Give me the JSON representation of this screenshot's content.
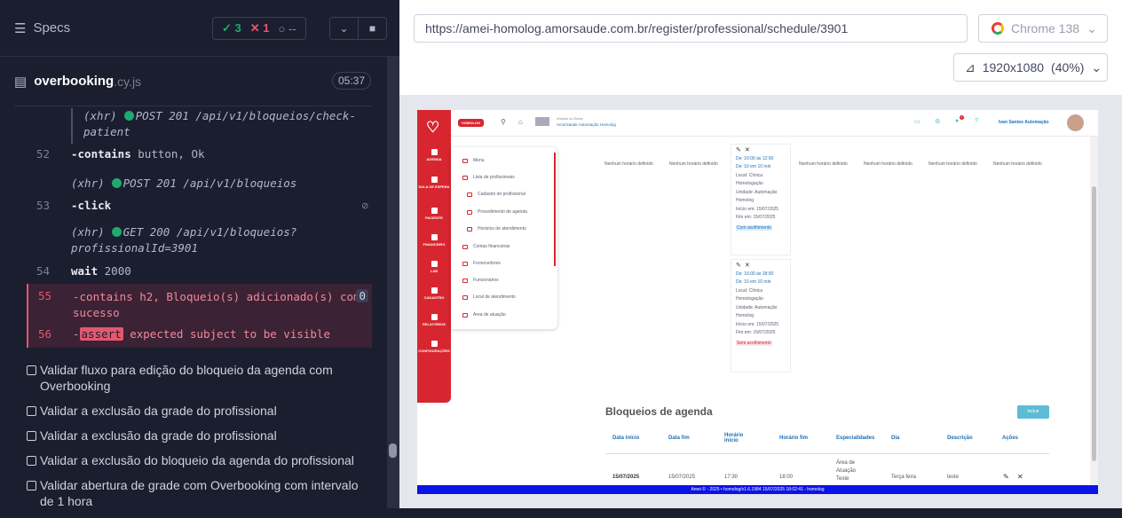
{
  "runner": {
    "specs_label": "Specs",
    "passed": "3",
    "failed": "1",
    "pending": "--",
    "file_name": "overbooking",
    "file_ext": ".cy.js",
    "timer": "05:37"
  },
  "log": [
    {
      "type": "xhr",
      "text1": "(xhr)",
      "text2": "POST 201 /api/v1/bloqueios/check-",
      "text3": "patient"
    },
    {
      "num": "52",
      "cmd": "-contains",
      "arg": "button, Ok"
    },
    {
      "type": "xhr",
      "text1": "(xhr)",
      "text2": "POST 201 /api/v1/bloqueios"
    },
    {
      "num": "53",
      "cmd": "-click"
    },
    {
      "type": "xhr",
      "text1": "(xhr)",
      "text2": "GET 200 /api/v1/bloqueios?",
      "text3": "profissionalId=3901"
    },
    {
      "num": "54",
      "cmd": "wait",
      "arg": "2000"
    },
    {
      "num": "55",
      "cmd": "-contains",
      "arg": "h2, Bloqueio(s) adicionado(s) com",
      "arg2": "sucesso",
      "count": "0"
    },
    {
      "num": "56",
      "cmd": "-",
      "badge": "assert",
      "arg": "expected subject to be visible"
    }
  ],
  "tests": [
    "Validar fluxo para edição do bloqueio da agenda com Overbooking",
    "Validar a exclusão da grade do profissional",
    "Validar a exclusão da grade do profissional",
    "Validar a exclusão do bloqueio da agenda do profissional",
    "Validar abertura de grade com Overbooking com intervalo de 1 hora"
  ],
  "browser": {
    "url": "https://amei-homolog.amorsaude.com.br/register/professional/schedule/3901",
    "name": "Chrome 138",
    "viewport": "1920x1080",
    "zoom": "(40%)"
  },
  "app": {
    "env_badge": "HOMOLOG",
    "clinic_label": "Unidade ou Clínica",
    "clinic_name": "AmorSaúde Automação Homolog",
    "user_name": "Ivan Santos Automação",
    "notif_count": "2",
    "sidebar": [
      "AGENDA",
      "SALA DE ESPERA",
      "PACIENTE",
      "FINANCEIRO",
      "LAB",
      "CADASTRO",
      "RELATÓRIOS",
      "CONFIGURAÇÕES"
    ],
    "menu": [
      "Menu",
      "Lista de profissionais",
      "Cadastro do profissional",
      "Procedimento de agenda",
      "Horários de atendimento",
      "Contas financeiras",
      "Fornecedores",
      "Funcionários",
      "Local de atendimento",
      "Área de atuação"
    ],
    "no_schedule": "Nenhum horário definido",
    "card1": {
      "de": "De: 10:00 às 12:00",
      "dur": "De: 10 em 10 min",
      "local": "Local: Clínica Homologação",
      "unidade": "Unidade: Automação Homolog",
      "inicio": "Início em: 15/07/2025",
      "fim": "Fim em: 15/07/2025",
      "tag": "Com acolhimento"
    },
    "card2": {
      "de": "De: 16:00 às 18:00",
      "dur": "De: 10 em 10 min",
      "local": "Local: Clínica Homologação",
      "unidade": "Unidade: Automação Homolog",
      "inicio": "Início em: 15/07/2025",
      "fim": "Fim em: 15/07/2025",
      "tag": "Sem acolhimento"
    },
    "bloqueios_title": "Bloqueios de agenda",
    "incluir": "Incluir",
    "table_headers": [
      "Data início",
      "Data fim",
      "Horário início",
      "Horário fim",
      "Especialidades",
      "Dia",
      "Descrição",
      "Ações"
    ],
    "row": [
      "15/07/2025",
      "15/07/2025",
      "17:30",
      "18:00",
      "Área de Atuação Teste",
      "Terça feira",
      "teste"
    ],
    "footer": "Amei © - 2025 • homolog/v1.6.1984 15/07/2025 18:02:41 - homolog"
  }
}
